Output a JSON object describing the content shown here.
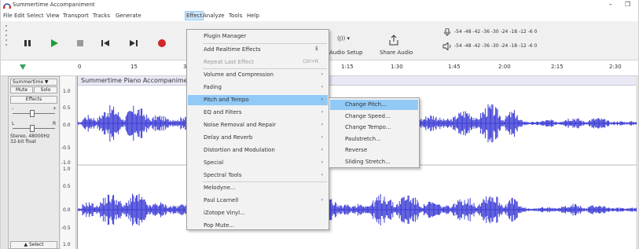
{
  "window": {
    "title": "Summertime Accompaniment",
    "minimize": "–",
    "maximize": "❐"
  },
  "menubar": [
    "File",
    "Edit",
    "Select",
    "View",
    "Transport",
    "Tracks",
    "Generate",
    "Effect",
    "Analyze",
    "Tools",
    "Help"
  ],
  "toolbar": {
    "audio_setup": "Audio Setup",
    "share_audio": "Share Audio",
    "audio_icon": "(ǀ)) ▾",
    "meter_scale": "-54  -48  -42  -36  -30  -24  -18  -12   -6   0",
    "meter_scale_2": "-54  -48  -42  -36  -30  -24  -18  -12   -6   0"
  },
  "ruler": {
    "ticks": [
      "0",
      "15",
      "3",
      "1:15",
      "1:30",
      "1:45",
      "2:00",
      "2:15",
      "2:30"
    ]
  },
  "track": {
    "name": "Summertime ▼",
    "mute": "Mute",
    "solo": "Solo",
    "effects": "Effects",
    "gain_minus": "-",
    "gain_plus": "+",
    "pan_left": "L",
    "pan_right": "R",
    "info_line1": "Stereo, 48000Hz",
    "info_line2": "32-bit float",
    "select": "Select",
    "clip_name": "Summertime Piano Accompaniment",
    "scale": [
      "1.0",
      "0.5",
      "0.0",
      "-0.5",
      "-1.0",
      "1.0",
      "0.5",
      "0.0",
      "-0.5",
      "1.0"
    ]
  },
  "effect_menu": {
    "items": [
      {
        "label": "Plugin Manager",
        "shortcut": "",
        "submenu": false,
        "disabled": false
      },
      {
        "label": "Add Realtime Effects",
        "shortcut": "E",
        "submenu": false,
        "disabled": false
      },
      {
        "label": "Repeat Last Effect",
        "shortcut": "Ctrl+R",
        "submenu": false,
        "disabled": true
      },
      {
        "label": "Volume and Compression",
        "shortcut": "",
        "submenu": true,
        "disabled": false
      },
      {
        "label": "Fading",
        "shortcut": "",
        "submenu": true,
        "disabled": false
      },
      {
        "label": "Pitch and Tempo",
        "shortcut": "",
        "submenu": true,
        "disabled": false
      },
      {
        "label": "EQ and Filters",
        "shortcut": "",
        "submenu": true,
        "disabled": false
      },
      {
        "label": "Noise Removal and Repair",
        "shortcut": "",
        "submenu": true,
        "disabled": false
      },
      {
        "label": "Delay and Reverb",
        "shortcut": "",
        "submenu": true,
        "disabled": false
      },
      {
        "label": "Distortion and Modulation",
        "shortcut": "",
        "submenu": true,
        "disabled": false
      },
      {
        "label": "Special",
        "shortcut": "",
        "submenu": true,
        "disabled": false
      },
      {
        "label": "Spectral Tools",
        "shortcut": "",
        "submenu": true,
        "disabled": false
      },
      {
        "label": "Melodyne...",
        "shortcut": "",
        "submenu": false,
        "disabled": false
      },
      {
        "label": "Paul Lcarnell",
        "shortcut": "",
        "submenu": true,
        "disabled": false
      },
      {
        "label": "iZotope Vinyl...",
        "shortcut": "",
        "submenu": false,
        "disabled": false
      },
      {
        "label": "Pop Mute...",
        "shortcut": "",
        "submenu": false,
        "disabled": false
      }
    ],
    "highlighted": "Pitch and Tempo"
  },
  "pitch_tempo_submenu": {
    "items": [
      "Change Pitch...",
      "Change Speed...",
      "Change Tempo...",
      "Paulstretch...",
      "Reverse",
      "Sliding Stretch..."
    ],
    "highlighted": "Change Pitch..."
  },
  "colors": {
    "waveform": "#3b3bd6",
    "menu_highlight": "#91c9f7",
    "record": "#d32626",
    "play": "#1b9d3a"
  }
}
